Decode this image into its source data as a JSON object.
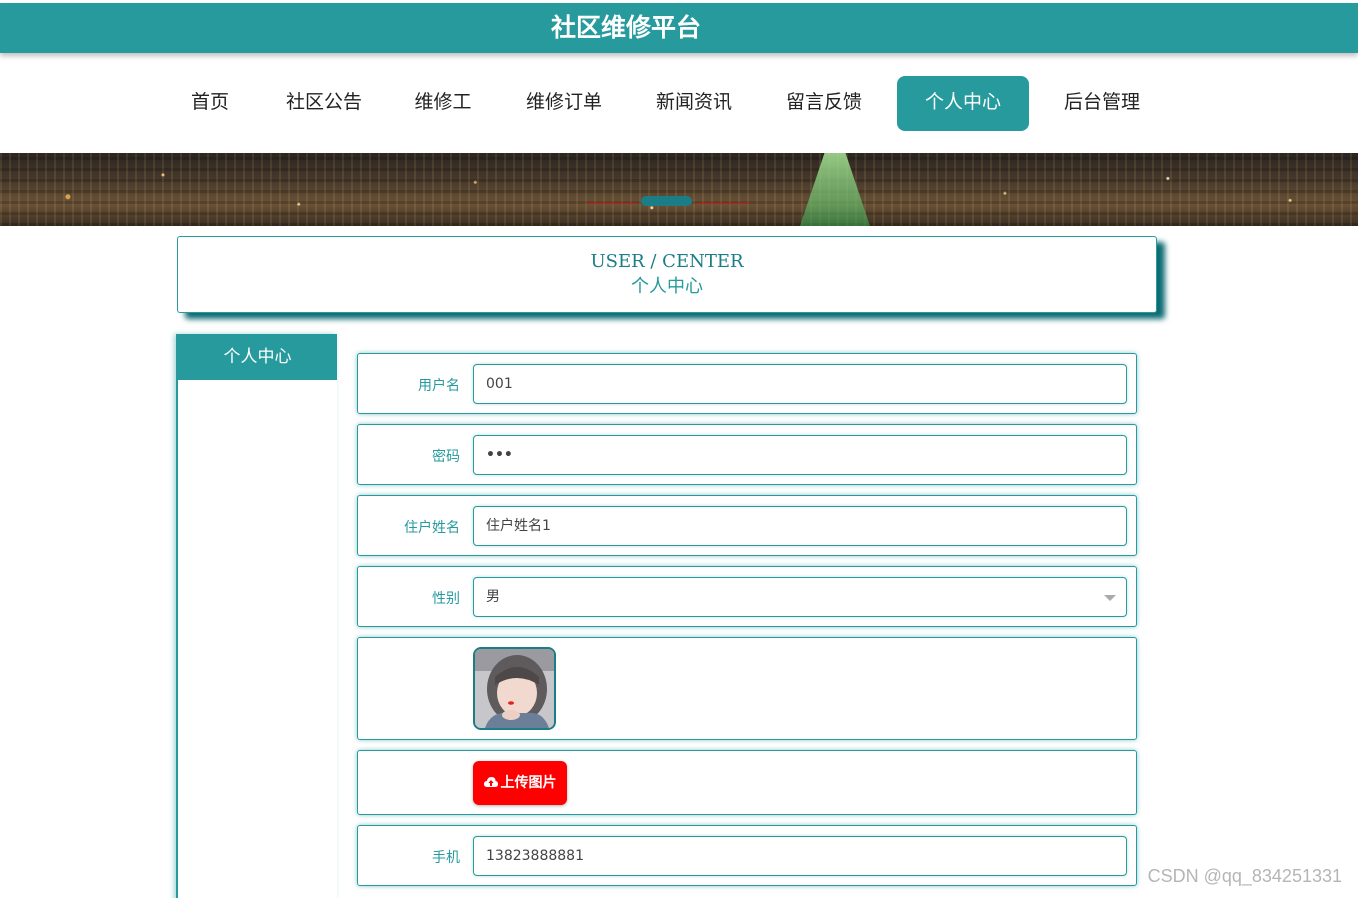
{
  "site": {
    "title": "社区维修平台"
  },
  "nav": {
    "items": [
      {
        "label": "首页"
      },
      {
        "label": "社区公告"
      },
      {
        "label": "维修工"
      },
      {
        "label": "维修订单"
      },
      {
        "label": "新闻资讯"
      },
      {
        "label": "留言反馈"
      },
      {
        "label": "个人中心",
        "active": true
      },
      {
        "label": "后台管理"
      }
    ]
  },
  "colors": {
    "primary": "#269a9c",
    "accent_dark": "#1b7d86",
    "upload": "#ff0000"
  },
  "page_title": {
    "en": "USER / CENTER",
    "cn": "个人中心"
  },
  "sidebar": {
    "tab_label": "个人中心"
  },
  "form": {
    "username": {
      "label": "用户名",
      "value": "001"
    },
    "password": {
      "label": "密码",
      "value": "•••"
    },
    "resident_name": {
      "label": "住户姓名",
      "value": "住户姓名1"
    },
    "gender": {
      "label": "性别",
      "value": "男"
    },
    "upload": {
      "label": "上传图片",
      "icon": "cloud-upload-icon"
    },
    "phone": {
      "label": "手机",
      "value": "13823888881"
    }
  },
  "watermark": "CSDN @qq_834251331"
}
